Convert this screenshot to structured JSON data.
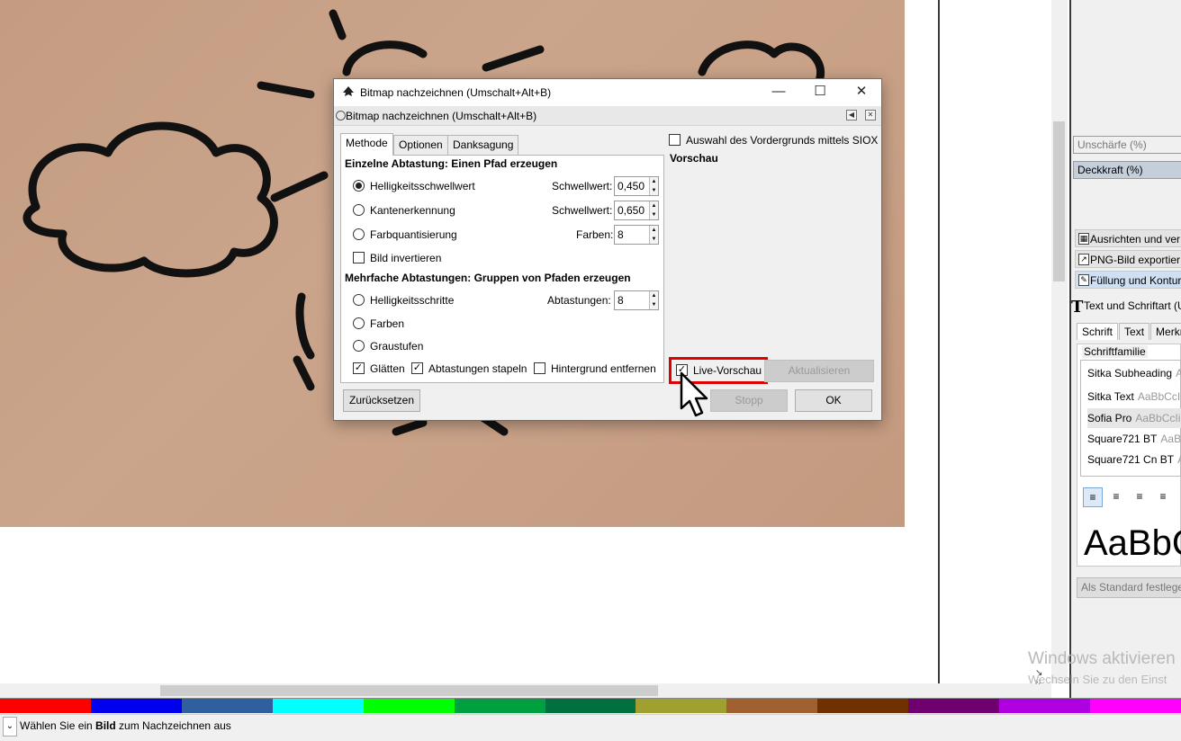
{
  "dialog": {
    "window_title": "Bitmap nachzeichnen (Umschalt+Alt+B)",
    "panel_title": "Bitmap nachzeichnen (Umschalt+Alt+B)",
    "tabs": [
      "Methode",
      "Optionen",
      "Danksagung"
    ],
    "single_scan": {
      "heading": "Einzelne Abtastung: Einen Pfad erzeugen",
      "options": [
        {
          "label": "Helligkeitsschwellwert",
          "selected": true,
          "param_label": "Schwellwert:",
          "value": "0,450"
        },
        {
          "label": "Kantenerkennung",
          "selected": false,
          "param_label": "Schwellwert:",
          "value": "0,650"
        },
        {
          "label": "Farbquantisierung",
          "selected": false,
          "param_label": "Farben:",
          "value": "8"
        }
      ],
      "invert_label": "Bild invertieren"
    },
    "multi_scan": {
      "heading": "Mehrfache Abtastungen: Gruppen von Pfaden erzeugen",
      "options": [
        {
          "label": "Helligkeitsschritte",
          "selected": false
        },
        {
          "label": "Farben",
          "selected": false
        },
        {
          "label": "Graustufen",
          "selected": false
        }
      ],
      "scans_label": "Abtastungen:",
      "scans_value": "8",
      "smooth_label": "Glätten",
      "stack_label": "Abtastungen stapeln",
      "remove_bg_label": "Hintergrund entfernen"
    },
    "siox_label": "Auswahl des Vordergrunds mittels SIOX",
    "preview_heading": "Vorschau",
    "live_preview_label": "Live-Vorschau",
    "update_label": "Aktualisieren",
    "reset_label": "Zurücksetzen",
    "stop_label": "Stopp",
    "ok_label": "OK"
  },
  "dock": {
    "blur_label": "Unschärfe (%)",
    "opacity_label": "Deckkraft (%)",
    "panels": [
      "Ausrichten und ver",
      "PNG-Bild exportier",
      "Füllung und Kontur"
    ],
    "text_panel_title": "Text und Schriftart (U",
    "text_tabs": [
      "Schrift",
      "Text",
      "Merkm"
    ],
    "font_family_label": "Schriftfamilie",
    "fonts": [
      {
        "name": "Sitka Subheading",
        "sample": "A"
      },
      {
        "name": "Sitka Text",
        "sample": "AaBbCcI"
      },
      {
        "name": "Sofia Pro",
        "sample": "AaBbCcIi"
      },
      {
        "name": "Square721 BT",
        "sample": "AaBb"
      },
      {
        "name": "Square721 Cn BT",
        "sample": "Aa"
      }
    ],
    "preview_text": "AaBbC",
    "set_default_label": "Als Standard festleger"
  },
  "watermark": {
    "line1": "Windows aktivieren",
    "line2": "Wechseln Sie zu den Einst"
  },
  "status": {
    "prefix": "Wählen Sie ein ",
    "bold": "Bild",
    "suffix": " zum Nachzeichnen aus"
  },
  "palette": [
    "#ff0000",
    "#0000ee",
    "#2f5f9c",
    "#00ffff",
    "#00ff00",
    "#00a040",
    "#007040",
    "#a0a030",
    "#a06030",
    "#703000",
    "#700070",
    "#b000e0",
    "#ff00ff"
  ],
  "colors": {
    "highlight": "#e00000",
    "photo": "#c8a086"
  }
}
